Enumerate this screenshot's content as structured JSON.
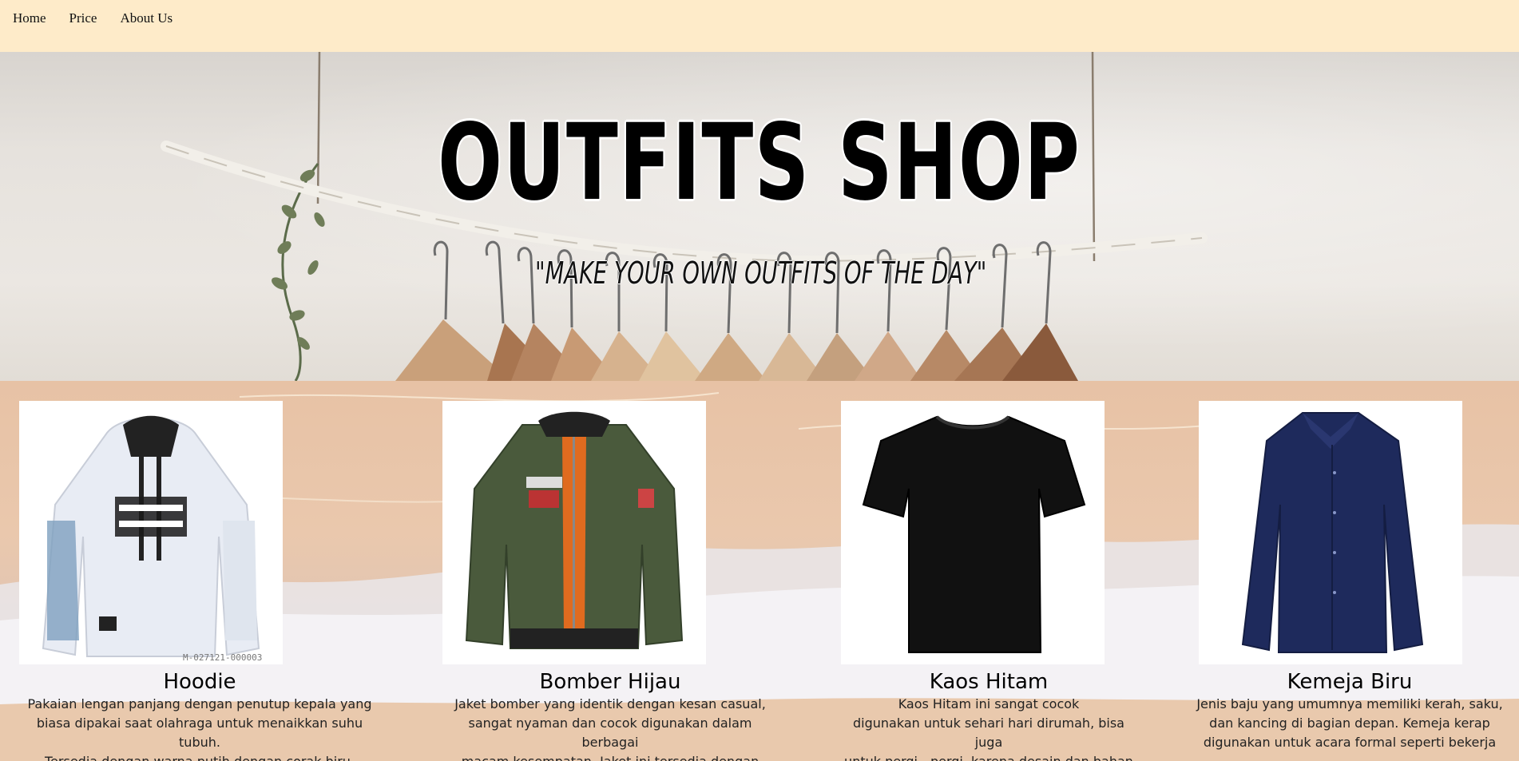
{
  "nav": {
    "items": [
      {
        "label": "Home"
      },
      {
        "label": "Price"
      },
      {
        "label": "About Us"
      }
    ]
  },
  "hero": {
    "title": "OUTFITS SHOP",
    "subtitle": "\"MAKE YOUR OWN OUTFITS OF THE DAY\""
  },
  "products": [
    {
      "name": "Hoodie",
      "image_icon": "hoodie-image",
      "image_caption": "M-027121-000003",
      "description": [
        "Pakaian lengan panjang dengan penutup kepala yang",
        "biasa dipakai saat olahraga untuk menaikkan suhu tubuh.",
        "Tersedia dengan warna putih dengan corak biru,"
      ]
    },
    {
      "name": "Bomber Hijau",
      "image_icon": "bomber-jacket-image",
      "description": [
        "Jaket bomber yang identik dengan kesan casual,",
        "sangat nyaman dan cocok digunakan dalam berbagai",
        "macam kesempatan. Jaket ini tersedia dengan"
      ]
    },
    {
      "name": "Kaos Hitam",
      "image_icon": "black-tshirt-image",
      "description": [
        "Kaos Hitam ini sangat cocok",
        "digunakan untuk sehari hari dirumah, bisa juga",
        "untuk pergi - pergi, karena desain dan bahan"
      ]
    },
    {
      "name": "Kemeja Biru",
      "image_icon": "blue-shirt-image",
      "description": [
        "Jenis baju yang umumnya memiliki kerah, saku,",
        "dan kancing di bagian depan. Kemeja kerap",
        "digunakan untuk acara formal seperti bekerja"
      ]
    }
  ],
  "colors": {
    "nav_bg": "#feebc9",
    "bomber_green": "#4a5a3c",
    "shirt_navy": "#1e2a5c"
  }
}
